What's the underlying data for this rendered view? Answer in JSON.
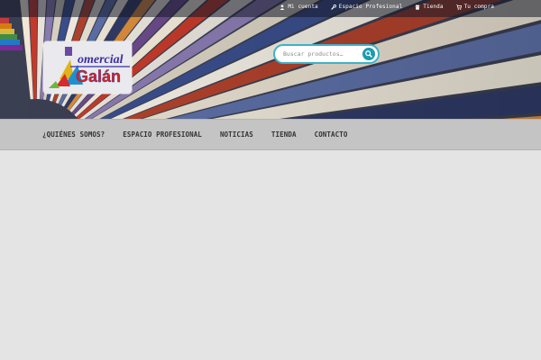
{
  "topbar": {
    "links": [
      {
        "label": "Mi cuenta",
        "icon": "user-icon"
      },
      {
        "label": "Espacio Profesional",
        "icon": "wrench-icon"
      },
      {
        "label": "Tienda",
        "icon": "shop-icon"
      },
      {
        "label": "Tu compra",
        "icon": "cart-icon"
      }
    ]
  },
  "logo": {
    "line1": "omercial",
    "line2": "Galán"
  },
  "search": {
    "placeholder": "Buscar productos…",
    "icon": "search-icon"
  },
  "nav": {
    "items": [
      {
        "label": "¿QUIÉNES SOMOS?"
      },
      {
        "label": "ESPACIO PROFESIONAL"
      },
      {
        "label": "NOTICIAS"
      },
      {
        "label": "TIENDA"
      },
      {
        "label": "CONTACTO"
      }
    ]
  },
  "colors": {
    "accent": "#1e9ab0",
    "nav_bg": "#c4c4c4",
    "page_bg": "#e4e4e4"
  }
}
